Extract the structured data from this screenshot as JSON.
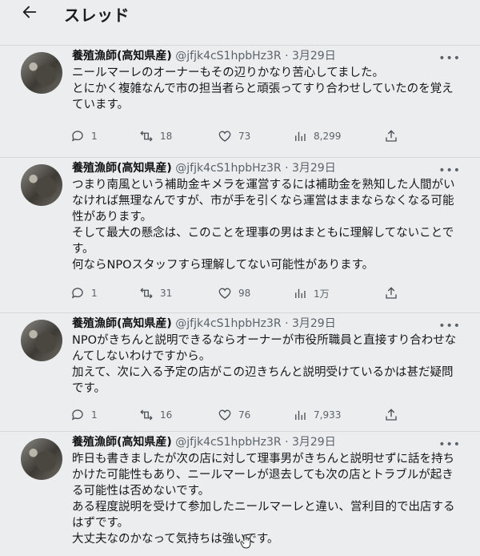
{
  "header": {
    "title": "スレッド",
    "back_icon": "arrow-left-icon"
  },
  "tweets": [
    {
      "name": "養殖漁師(高知県産)",
      "handle": "@jfjk4cS1hpbHz3R",
      "dot": "·",
      "date": "3月29日",
      "text": "ニールマーレのオーナーもその辺りかなり苦心してました。\nとにかく複雑なんで市の担当者らと頑張ってすり合わせしていたのを覚えています。",
      "replies": "1",
      "retweets": "18",
      "likes": "73",
      "views": "8,299"
    },
    {
      "name": "養殖漁師(高知県産)",
      "handle": "@jfjk4cS1hpbHz3R",
      "dot": "·",
      "date": "3月29日",
      "text": "つまり南風という補助金キメラを運営するには補助金を熟知した人間がいなければ無理なんですが、市が手を引くなら運営はままならなくなる可能性があります。\nそして最大の懸念は、このことを理事の男はまともに理解してないことです。\n何ならNPOスタッフすら理解してない可能性があります。",
      "replies": "1",
      "retweets": "31",
      "likes": "98",
      "views": "1万"
    },
    {
      "name": "養殖漁師(高知県産)",
      "handle": "@jfjk4cS1hpbHz3R",
      "dot": "·",
      "date": "3月29日",
      "text": "NPOがきちんと説明できるならオーナーが市役所職員と直接すり合わせなんてしないわけですから。\n加えて、次に入る予定の店がこの辺きちんと説明受けているかは甚だ疑問です。",
      "replies": "1",
      "retweets": "16",
      "likes": "76",
      "views": "7,933"
    },
    {
      "name": "養殖漁師(高知県産)",
      "handle": "@jfjk4cS1hpbHz3R",
      "dot": "·",
      "date": "3月29日",
      "text": "昨日も書きましたが次の店に対して理事男がきちんと説明せずに話を持ちかけた可能性もあり、ニールマーレが退去しても次の店とトラブルが起きる可能性は否めないです。\nある程度説明を受けて参加したニールマーレと違い、営利目的で出店するはずです。\n大丈夫なのかなって気持ちは強いです。"
    }
  ],
  "icons": {
    "more": "more-horizontal-icon",
    "reply": "reply-icon",
    "retweet": "retweet-icon",
    "like": "heart-icon",
    "views": "views-chart-icon",
    "share": "share-icon"
  },
  "colors": {
    "background": "#ecedee",
    "text": "#15181c",
    "secondary": "#5b6269"
  }
}
